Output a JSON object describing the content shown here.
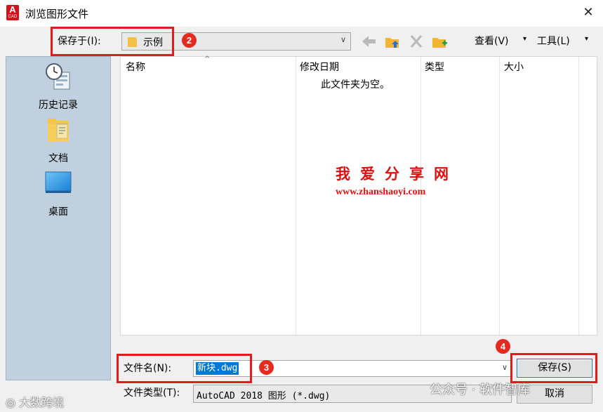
{
  "window": {
    "icon_text": "A",
    "icon_subtext": "CAD",
    "title": "浏览图形文件",
    "close_glyph": "✕"
  },
  "toolbar": {
    "save_in_label": "保存于(I):",
    "current_folder": "示例",
    "view_menu": "查看(V)",
    "tools_menu": "工具(L)",
    "dropdown_glyph": "▾"
  },
  "places": [
    {
      "label": "历史记录",
      "icon": "history-icon"
    },
    {
      "label": "文档",
      "icon": "documents-folder-icon"
    },
    {
      "label": "桌面",
      "icon": "desktop-icon"
    }
  ],
  "file_list": {
    "columns": [
      "名称",
      "修改日期",
      "类型",
      "大小"
    ],
    "empty_message": "此文件夹为空。",
    "sort_glyph": "^"
  },
  "form": {
    "filename_label": "文件名(N):",
    "filename_value": "新块.dwg",
    "filetype_label": "文件类型(T):",
    "filetype_value": "AutoCAD 2018 图形 (*.dwg)",
    "save_button": "保存(S)",
    "cancel_button": "取消"
  },
  "watermark": {
    "title": "我爱分享网",
    "url": "www.zhanshaoyi.com",
    "corner_left": "◎ 大数跨境",
    "corner_right": "公众号 · 软件智库"
  },
  "annotations": {
    "step_2": "2",
    "step_3": "3",
    "step_4": "4",
    "color": "#e21c1c"
  },
  "colors": {
    "accent": "#0078d7",
    "sidebar": "#c0d0de",
    "annotation_red": "#e21c1c"
  }
}
